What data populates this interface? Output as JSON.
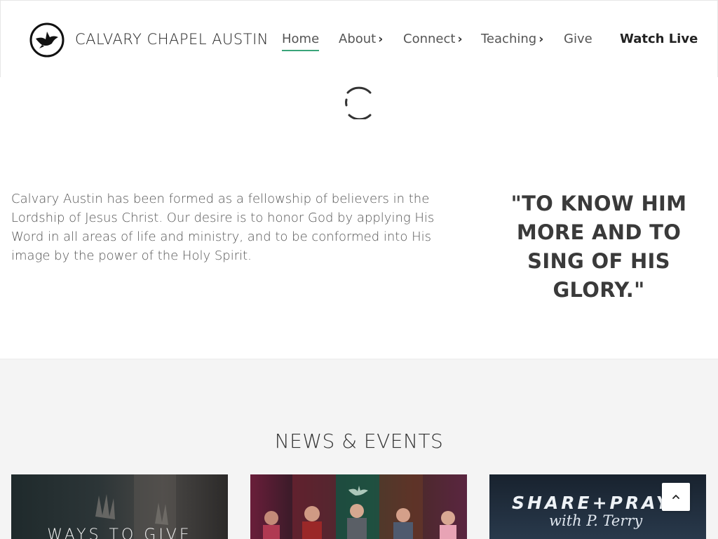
{
  "header": {
    "brand": "CALVARY CHAPEL AUSTIN",
    "logo_icon": "dove-icon",
    "nav": {
      "home": "Home",
      "about": "About",
      "connect": "Connect",
      "teaching": "Teaching",
      "give": "Give"
    },
    "watch_live": "Watch Live",
    "accent_color": "#3aa57a"
  },
  "intro": {
    "text": "Calvary Austin has been formed as a fellowship of believers in the Lordship of Jesus Christ. Our desire is to honor God by applying His Word in all areas of life and ministry, and to be conformed into His image by the power of the Holy Spirit.",
    "quote": "\"TO KNOW HIM MORE AND TO SING OF HIS GLORY.\""
  },
  "news": {
    "title": "NEWS & EVENTS",
    "cards": [
      {
        "label": "WAYS TO GIVE"
      },
      {
        "label": ""
      },
      {
        "title": "SHARE+PRAY",
        "subtitle": "with P. Terry"
      }
    ]
  },
  "back_to_top_icon": "chevron-up-icon"
}
